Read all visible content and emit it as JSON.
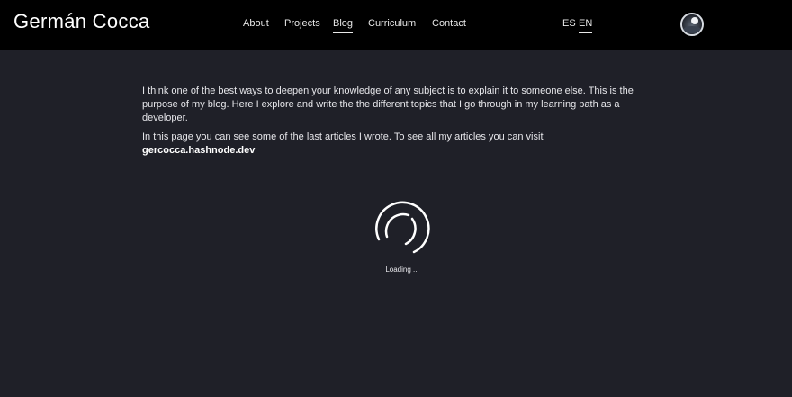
{
  "header": {
    "title": "Germán Cocca",
    "nav": [
      {
        "label": "About",
        "active": false
      },
      {
        "label": "Projects",
        "active": false
      },
      {
        "label": "Blog",
        "active": true
      },
      {
        "label": "Curriculum",
        "active": false
      },
      {
        "label": "Contact",
        "active": false
      }
    ],
    "languages": [
      {
        "label": "ES",
        "active": false
      },
      {
        "label": "EN",
        "active": true
      }
    ],
    "theme_toggle_icon": "moon-icon"
  },
  "main": {
    "intro_paragraph": "I think one of the best ways to deepen your knowledge of any subject is to explain it to someone else. This is the purpose of my blog. Here I explore and write the the different topics that I go through in my learning path as a developer.",
    "articles_text": "In this page you can see some of the last articles I wrote. To see all my articles you can visit",
    "articles_link": "gercocca.hashnode.dev",
    "loading_text": "Loading ..."
  },
  "colors": {
    "header_bg": "#000000",
    "page_bg": "#1f2028",
    "text": "#e6e6ea"
  }
}
